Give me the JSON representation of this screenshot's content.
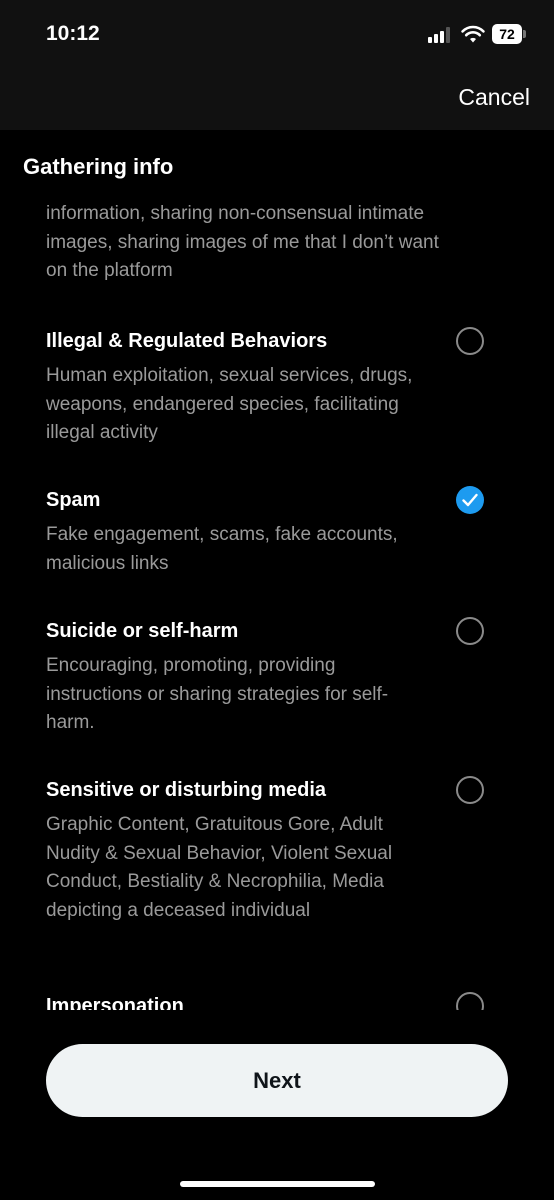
{
  "status_bar": {
    "time": "10:12",
    "battery": "72"
  },
  "header": {
    "cancel_label": "Cancel",
    "section_title": "Gathering info"
  },
  "list": {
    "partial_description": "information, sharing non-consensual intimate images, sharing images of me that I don’t want on the platform",
    "options": [
      {
        "title": "Illegal & Regulated Behaviors",
        "description": "Human exploitation, sexual services, drugs, weapons, endangered species, facilitating illegal activity",
        "selected": false
      },
      {
        "title": "Spam",
        "description": "Fake engagement, scams, fake accounts, malicious links",
        "selected": true
      },
      {
        "title": "Suicide or self-harm",
        "description": "Encouraging, promoting, providing instructions or sharing strategies for self-harm.",
        "selected": false
      },
      {
        "title": "Sensitive or disturbing media",
        "description": "Graphic Content, Gratuitous Gore, Adult Nudity & Sexual Behavior, Violent Sexual Conduct, Bestiality & Necrophilia, Media depicting a deceased individual",
        "selected": false
      },
      {
        "title": "Impersonation",
        "description": "",
        "selected": false
      }
    ]
  },
  "footer": {
    "next_label": "Next"
  },
  "colors": {
    "accent": "#1d9bf0",
    "background": "#000000",
    "secondary_text": "#9a9a9a",
    "button_bg": "#eff3f4"
  },
  "icons": {
    "selected": "checkmark-icon",
    "cellular": "cellular-signal-icon",
    "wifi": "wifi-icon",
    "battery": "battery-icon"
  }
}
